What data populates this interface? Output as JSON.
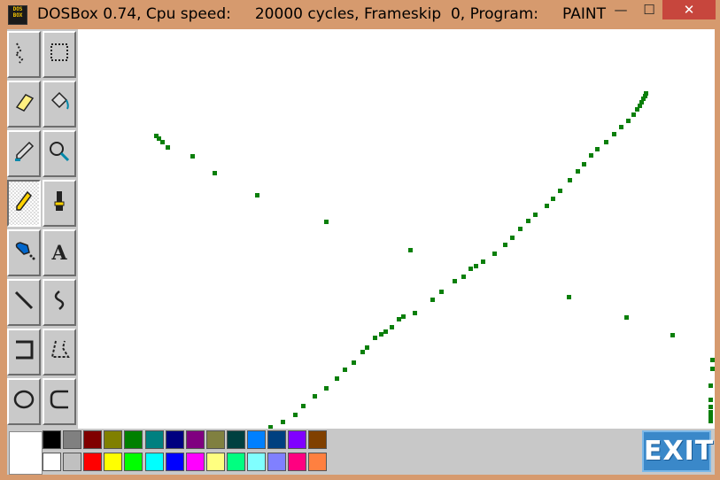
{
  "window": {
    "title": "DOSBox 0.74, Cpu speed:     20000 cycles, Frameskip  0, Program:     PAINT",
    "icon_name": "dosbox-icon",
    "icon_text": "DOS BOX",
    "minimize_glyph": "—",
    "maximize_glyph": "☐",
    "close_glyph": "✕"
  },
  "tools": [
    {
      "name": "free-select-tool-icon",
      "glyph": ""
    },
    {
      "name": "rect-select-tool-icon",
      "glyph": ""
    },
    {
      "name": "eraser-tool-icon",
      "glyph": ""
    },
    {
      "name": "fill-tool-icon",
      "glyph": ""
    },
    {
      "name": "eyedropper-tool-icon",
      "glyph": ""
    },
    {
      "name": "magnifier-tool-icon",
      "glyph": ""
    },
    {
      "name": "pencil-tool-icon",
      "glyph": "",
      "selected": true
    },
    {
      "name": "brush-tool-icon",
      "glyph": ""
    },
    {
      "name": "airbrush-tool-icon",
      "glyph": ""
    },
    {
      "name": "text-tool-icon",
      "glyph": "A"
    },
    {
      "name": "line-tool-icon",
      "glyph": ""
    },
    {
      "name": "curve-tool-icon",
      "glyph": ""
    },
    {
      "name": "rectangle-tool-icon",
      "glyph": ""
    },
    {
      "name": "polygon-tool-icon",
      "glyph": ""
    },
    {
      "name": "ellipse-tool-icon",
      "glyph": ""
    },
    {
      "name": "rounded-rect-tool-icon",
      "glyph": ""
    }
  ],
  "palette": {
    "current_color": "#ffffff",
    "top_row": [
      "#000000",
      "#808080",
      "#800000",
      "#808000",
      "#008000",
      "#008080",
      "#000080",
      "#800080",
      "#808040",
      "#004040",
      "#0080ff",
      "#004080",
      "#8000ff",
      "#804000"
    ],
    "bottom_row": [
      "#ffffff",
      "#c0c0c0",
      "#ff0000",
      "#ffff00",
      "#00ff00",
      "#00ffff",
      "#0000ff",
      "#ff00ff",
      "#ffff80",
      "#00ff80",
      "#80ffff",
      "#8080ff",
      "#ff0080",
      "#ff8040"
    ]
  },
  "exit_label": "EXIT",
  "drawing_color": "#0a7f0a"
}
